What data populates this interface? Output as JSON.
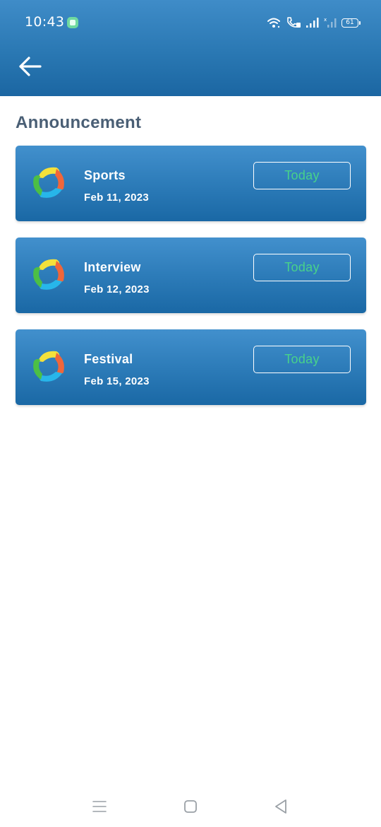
{
  "status_bar": {
    "time": "10:43",
    "battery_level": "61",
    "icons": [
      "chat-notification-icon",
      "wifi-icon",
      "volte-call-icon",
      "signal-icon",
      "signal-no-service-icon",
      "battery-icon"
    ]
  },
  "app_bar": {
    "back_icon": "arrow-left-icon"
  },
  "page": {
    "title": "Announcement"
  },
  "announcements": [
    {
      "title": "Sports",
      "date": "Feb 11, 2023",
      "badge": "Today",
      "logo_icon": "app-logo-icon"
    },
    {
      "title": "Interview",
      "date": "Feb 12, 2023",
      "badge": "Today",
      "logo_icon": "app-logo-icon"
    },
    {
      "title": "Festival",
      "date": "Feb 15, 2023",
      "badge": "Today",
      "logo_icon": "app-logo-icon"
    }
  ],
  "colors": {
    "app_bar": "#2a78b3",
    "card": "#2d7cb9",
    "title_text": "#4a5f75",
    "today_text": "#48d28a"
  },
  "nav_bar": {
    "icons": [
      "menu-lines-icon",
      "home-square-icon",
      "back-triangle-icon"
    ]
  }
}
